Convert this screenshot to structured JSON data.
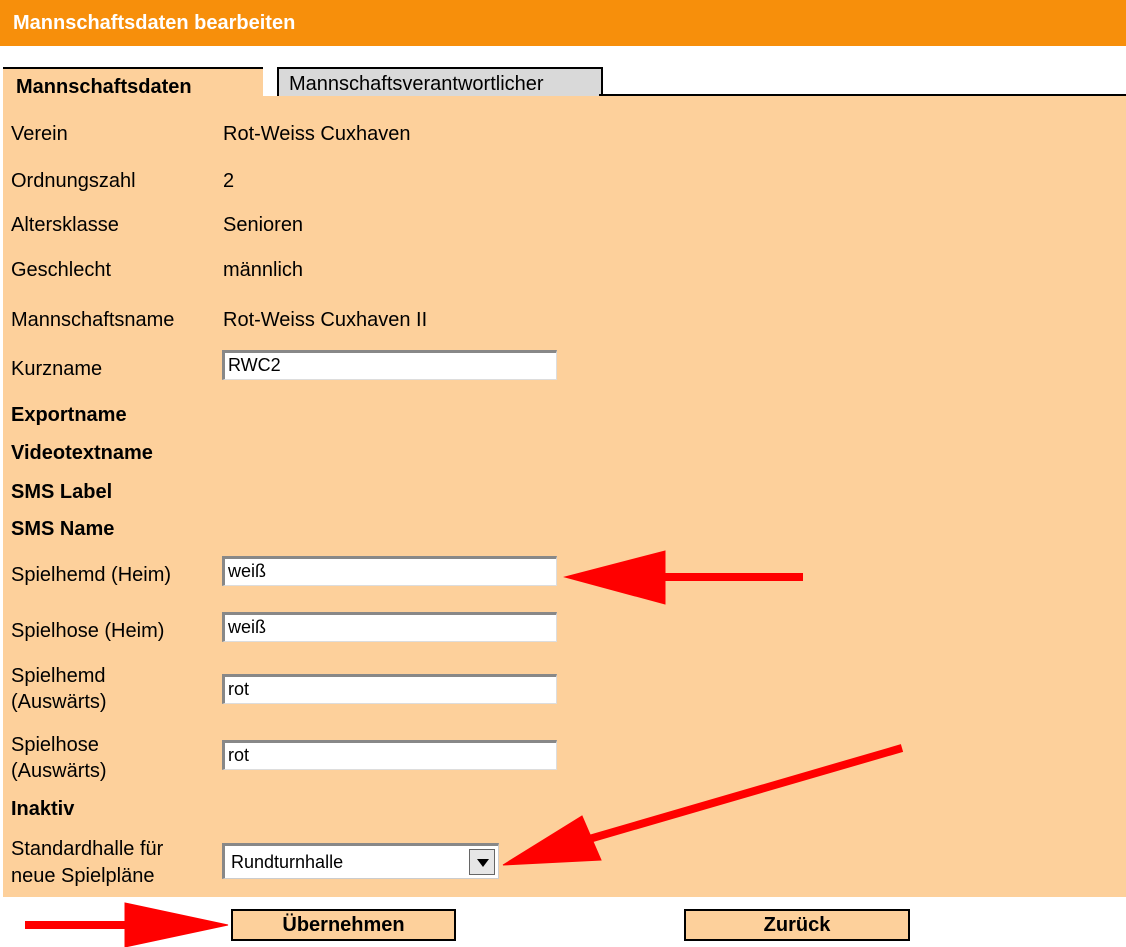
{
  "header": {
    "title": "Mannschaftsdaten bearbeiten"
  },
  "tabs": {
    "active": "Mannschaftsdaten",
    "inactive": "Mannschaftsverantwortlicher"
  },
  "info": {
    "verein_label": "Verein",
    "verein_value": "Rot-Weiss Cuxhaven",
    "ordnung_label": "Ordnungszahl",
    "ordnung_value": "2",
    "alter_label": "Altersklasse",
    "alter_value": "Senioren",
    "geschlecht_label": "Geschlecht",
    "geschlecht_value": "männlich",
    "mname_label": "Mannschaftsname",
    "mname_value": "Rot-Weiss Cuxhaven II"
  },
  "fields": {
    "kurzname_label": "Kurzname",
    "kurzname_value": "RWC2",
    "exportname_label": "Exportname",
    "videotext_label": "Videotextname",
    "smslabel_label": "SMS Label",
    "smsname_label": "SMS Name",
    "hemd_heim_label": "Spielhemd (Heim)",
    "hemd_heim_value": "weiß",
    "hose_heim_label": "Spielhose (Heim)",
    "hose_heim_value": "weiß",
    "hemd_aus_label_1": "Spielhemd",
    "hemd_aus_label_2": "(Auswärts)",
    "hemd_aus_value": "rot",
    "hose_aus_label_1": "Spielhose",
    "hose_aus_label_2": "(Auswärts)",
    "hose_aus_value": "rot",
    "inaktiv_label": "Inaktiv",
    "halle_label_1": "Standardhalle für",
    "halle_label_2": "neue Spielpläne",
    "halle_value": "Rundturnhalle"
  },
  "buttons": {
    "submit": "Übernehmen",
    "back": "Zurück"
  },
  "colors": {
    "header": "#f78f0b",
    "panel": "#fdd09b",
    "annotation_arrow": "#ff0000"
  }
}
